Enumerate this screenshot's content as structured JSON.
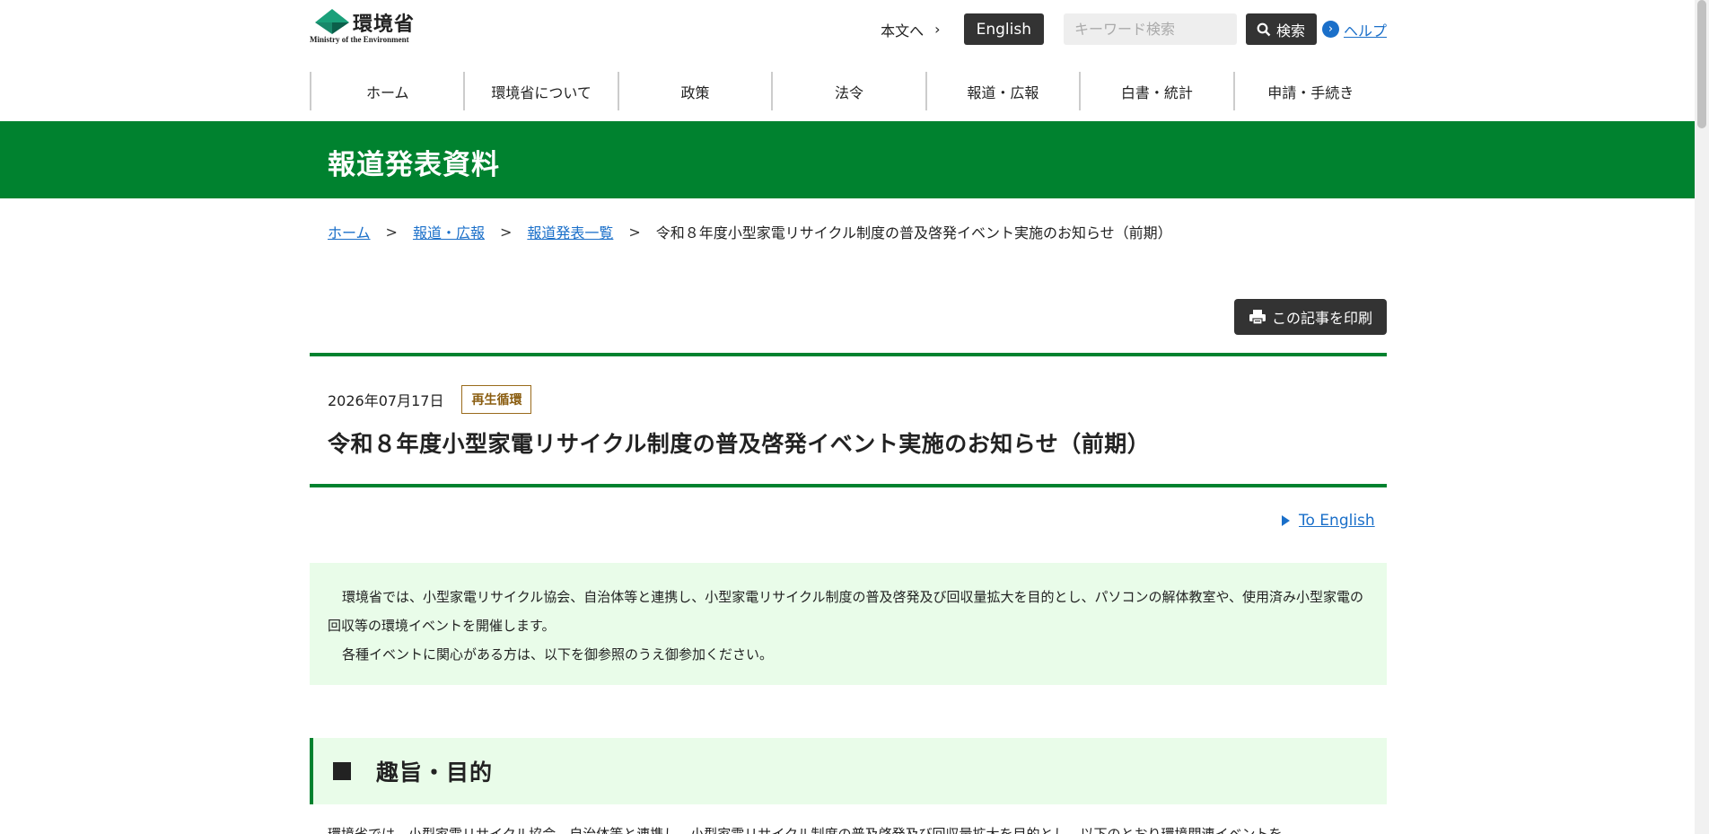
{
  "header": {
    "logo_jp": "環境省",
    "logo_en": "Ministry of the Environment",
    "skip_label": "本文へ",
    "english_button": "English",
    "search_placeholder": "キーワード検索",
    "search_button": "検索",
    "help_link": "ヘルプ"
  },
  "nav": {
    "items": [
      {
        "label": "ホーム"
      },
      {
        "label": "環境省について"
      },
      {
        "label": "政策"
      },
      {
        "label": "法令"
      },
      {
        "label": "報道・広報"
      },
      {
        "label": "白書・統計"
      },
      {
        "label": "申請・手続き"
      }
    ]
  },
  "band": {
    "title": "報道発表資料"
  },
  "breadcrumb": {
    "items": [
      {
        "label": "ホーム"
      },
      {
        "label": "報道・広報"
      },
      {
        "label": "報道発表一覧"
      }
    ],
    "current": "令和８年度小型家電リサイクル制度の普及啓発イベント実施のお知らせ（前期）",
    "separator": ">"
  },
  "print_button": "この記事を印刷",
  "article": {
    "date": "2026年07月17日",
    "tag": "再生循環",
    "title": "令和８年度小型家電リサイクル制度の普及啓発イベント実施のお知らせ（前期）"
  },
  "to_english": "To English",
  "summary": {
    "p1": "環境省では、小型家電リサイクル協会、自治体等と連携し、小型家電リサイクル制度の普及啓発及び回収量拡大を目的とし、パソコンの解体教室や、使用済み小型家電の回収等の環境イベントを開催します。",
    "p2": "各種イベントに関心がある方は、以下を御参照のうえ御参加ください。"
  },
  "section": {
    "heading": "趣旨・目的"
  },
  "cut_text": "環境省では、小型家電リサイクル協会、自治体等と連携し、小型家電リサイクル制度の普及啓発及び回収量拡大を目的とし、以下のとおり環境関連イベントを",
  "colors": {
    "brand_green": "#00822f",
    "light_green": "#e9fce9",
    "link_blue": "#1a6fc9",
    "dark_button": "#333333"
  }
}
